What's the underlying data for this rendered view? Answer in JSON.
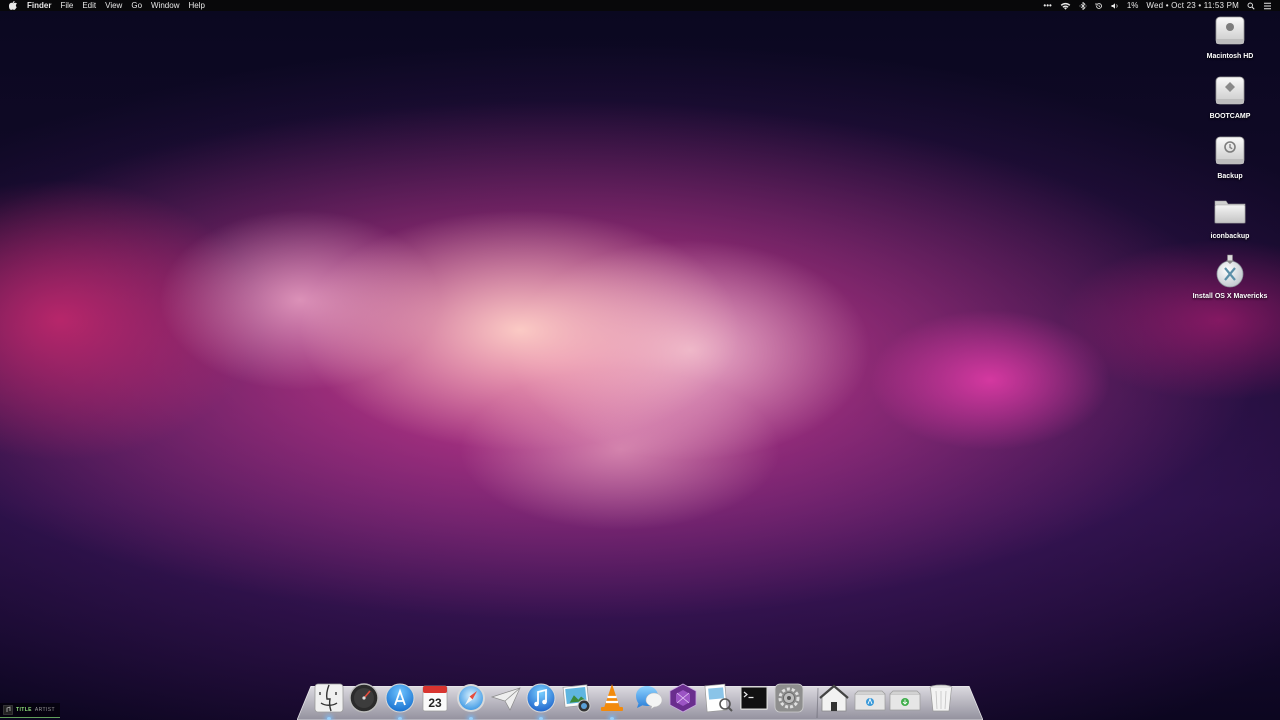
{
  "menubar": {
    "app_name": "Finder",
    "menus": [
      "File",
      "Edit",
      "View",
      "Go",
      "Window",
      "Help"
    ],
    "status": {
      "overflow": "•••",
      "battery": "1%",
      "clock": "Wed  •  Oct 23  •  11:53 PM"
    }
  },
  "desktop": {
    "icons": [
      {
        "label": "Macintosh HD",
        "icon": "hard-drive-icon"
      },
      {
        "label": "BOOTCAMP",
        "icon": "bootcamp-drive-icon"
      },
      {
        "label": "Backup",
        "icon": "time-machine-drive-icon"
      },
      {
        "label": "iconbackup",
        "icon": "folder-icon"
      },
      {
        "label": "Install OS X Mavericks",
        "icon": "os-x-installer-icon"
      }
    ]
  },
  "dock": {
    "apps": [
      {
        "icon": "finder-icon",
        "running": true
      },
      {
        "icon": "dashboard-icon",
        "running": false
      },
      {
        "icon": "app-store-icon",
        "running": true
      },
      {
        "icon": "calendar-icon",
        "running": false,
        "text": "23"
      },
      {
        "icon": "safari-icon",
        "running": true
      },
      {
        "icon": "mail-icon",
        "running": false
      },
      {
        "icon": "itunes-icon",
        "running": true
      },
      {
        "icon": "iphoto-icon",
        "running": false
      },
      {
        "icon": "vlc-icon",
        "running": true
      },
      {
        "icon": "messages-icon",
        "running": false
      },
      {
        "icon": "purple-app-icon",
        "running": false
      },
      {
        "icon": "preview-icon",
        "running": false
      },
      {
        "icon": "terminal-icon",
        "running": false
      },
      {
        "icon": "system-preferences-icon",
        "running": false
      }
    ],
    "stacks": [
      {
        "icon": "home-folder-icon"
      },
      {
        "icon": "applications-stack-icon"
      },
      {
        "icon": "downloads-stack-icon"
      },
      {
        "icon": "trash-icon"
      }
    ]
  },
  "now_playing": {
    "title": "TITLE",
    "artist": "ARTIST"
  },
  "colors": {
    "menubar_bg": "#08080a",
    "running_indicator": "#96d2ff",
    "now_playing_title": "#8fe07a"
  }
}
